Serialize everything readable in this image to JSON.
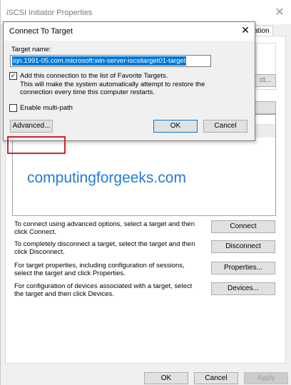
{
  "parent": {
    "title": "iSCSI Initiator Properties",
    "close_glyph": "✕",
    "tab_fragment": "ation",
    "ghost_button_fragment": "ct...",
    "targets_list": {
      "watermark": "computingforgeeks.com"
    },
    "actions": [
      {
        "description": "To connect using advanced options, select a target and then click Connect.",
        "button": "Connect"
      },
      {
        "description": "To completely disconnect a target, select the target and then click Disconnect.",
        "button": "Disconnect"
      },
      {
        "description": "For target properties, including configuration of sessions, select the target and click Properties.",
        "button": "Properties..."
      },
      {
        "description": "For configuration of devices associated with a target, select the target and then click Devices.",
        "button": "Devices..."
      }
    ],
    "footer": {
      "ok": "OK",
      "cancel": "Cancel",
      "apply": "Apply"
    }
  },
  "dialog": {
    "title": "Connect To Target",
    "close_glyph": "✕",
    "target_name_label": "Target name:",
    "target_name_value": "iqn.1991-05.com.microsoft:win-server-iscsitarget01-target",
    "favorite": {
      "checked": true,
      "check_glyph": "✓",
      "label": "Add this connection to the list of Favorite Targets.",
      "description": "This will make the system automatically attempt to restore the connection every time this computer restarts."
    },
    "multipath": {
      "checked": false,
      "label": "Enable multi-path"
    },
    "buttons": {
      "advanced": "Advanced...",
      "ok": "OK",
      "cancel": "Cancel"
    },
    "highlight_color": "#d0262b"
  }
}
